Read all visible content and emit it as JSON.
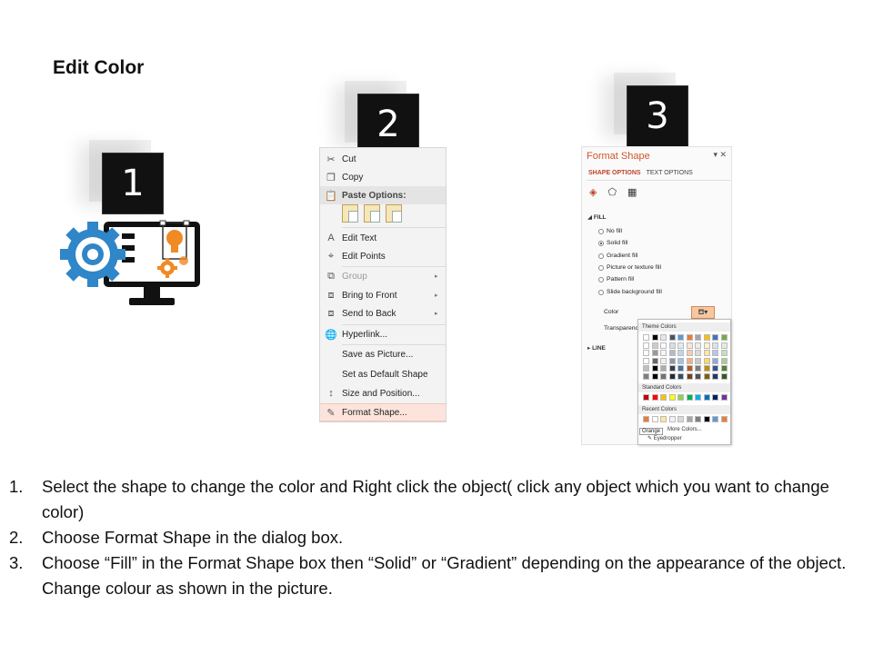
{
  "title": "Edit Color",
  "steps": {
    "numbers": [
      "1",
      "2",
      "3"
    ]
  },
  "context_menu": {
    "items": [
      {
        "label": "Cut",
        "icon": "scissors-icon"
      },
      {
        "label": "Copy",
        "icon": "copy-icon"
      },
      {
        "label": "Paste Options:",
        "icon": "paste-icon"
      },
      {
        "label": "Edit Text",
        "icon": "edit-text-icon"
      },
      {
        "label": "Edit Points",
        "icon": "edit-points-icon"
      },
      {
        "label": "Group",
        "icon": "group-icon",
        "arrow": "▸"
      },
      {
        "label": "Bring to Front",
        "icon": "bring-front-icon",
        "arrow": "▸"
      },
      {
        "label": "Send to Back",
        "icon": "send-back-icon",
        "arrow": "▸"
      },
      {
        "label": "Hyperlink...",
        "icon": "hyperlink-icon"
      },
      {
        "label": "Save as Picture...",
        "icon": ""
      },
      {
        "label": "Set as Default Shape",
        "icon": ""
      },
      {
        "label": "Size and Position...",
        "icon": "size-position-icon"
      },
      {
        "label": "Format Shape...",
        "icon": "format-shape-icon"
      }
    ]
  },
  "format_pane": {
    "title": "Format Shape",
    "tab_shape": "SHAPE OPTIONS",
    "tab_text": "TEXT OPTIONS",
    "fill_section": "FILL",
    "options": [
      "No fill",
      "Solid fill",
      "Gradient fill",
      "Picture or texture fill",
      "Pattern fill",
      "Slide background fill"
    ],
    "selected_option": "Solid fill",
    "color_label": "Color",
    "transparency_label": "Transparenc",
    "line_section": "LINE"
  },
  "palette": {
    "theme_label": "Theme Colors",
    "standard_label": "Standard Colors",
    "recent_label": "Recent Colors",
    "more_colors": "More Colors...",
    "eyedropper": "Eyedropper",
    "tooltip": "Orange",
    "theme_top": [
      "#ffffff",
      "#000000",
      "#e7e6e6",
      "#44546a",
      "#5b9bd5",
      "#ed7d31",
      "#a5a5a5",
      "#ffc000",
      "#4472c4",
      "#70ad47"
    ],
    "standard": [
      "#c00000",
      "#ff0000",
      "#ffc000",
      "#ffff00",
      "#92d050",
      "#00b050",
      "#00b0f0",
      "#0070c0",
      "#002060",
      "#7030a0"
    ],
    "recent": [
      "#ed7d31",
      "#ffffff",
      "#ffe699",
      "#f2f2f2",
      "#d9d9d9",
      "#a6a6a6",
      "#7f7f7f",
      "#000000",
      "#5b9bd5",
      "#ed7d31"
    ]
  },
  "instructions": [
    {
      "num": "1.",
      "text": "Select the shape to change the color and Right click the object( click any object which you want to change color)"
    },
    {
      "num": "2.",
      "text": "Choose Format Shape in the dialog box."
    },
    {
      "num": "3.",
      "text": "Choose “Fill” in the Format Shape box then “Solid” or “Gradient” depending on the appearance of the object. Change colour as shown in the picture."
    }
  ],
  "colors": {
    "accent": "#d0572d",
    "gear": "#2f86c8",
    "bulb": "#f08a24",
    "dark": "#111111"
  }
}
